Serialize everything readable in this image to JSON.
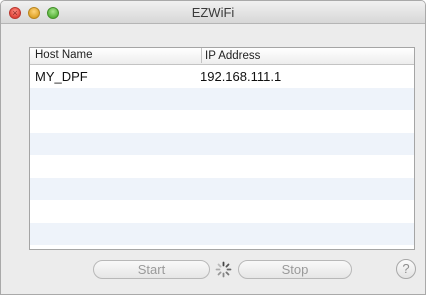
{
  "window": {
    "title": "EZWiFi"
  },
  "table": {
    "columns": [
      "Host Name",
      "IP Address"
    ],
    "rows": [
      [
        "MY_DPF",
        "192.168.111.1"
      ]
    ]
  },
  "buttons": {
    "start_label": "Start",
    "stop_label": "Stop",
    "help_label": "?"
  },
  "icons": {
    "spinner": "progress-spinner-icon",
    "help": "help-icon",
    "close": "close-window-icon",
    "minimize": "minimize-window-icon",
    "zoom": "zoom-window-icon"
  },
  "colors": {
    "window_bg": "#ececec",
    "alt_row": "#eef3fa",
    "close": "#e0443a",
    "minimize": "#e0a52a",
    "zoom": "#59b43b"
  }
}
